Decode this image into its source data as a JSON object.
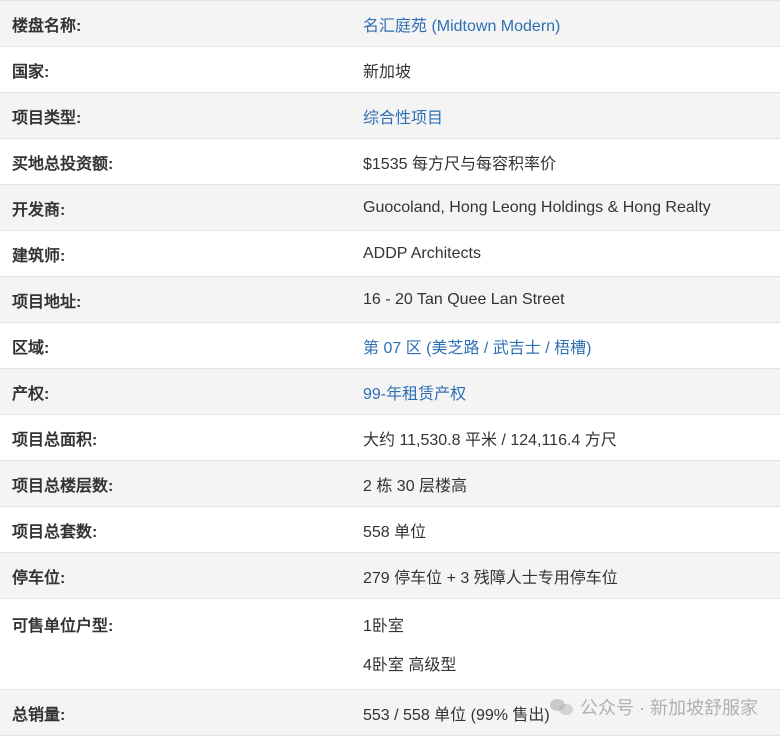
{
  "rows": [
    {
      "label": "楼盘名称:",
      "value": "名汇庭苑 (Midtown Modern)"
    },
    {
      "label": "国家:",
      "value": "新加坡"
    },
    {
      "label": "项目类型:",
      "value": "综合性项目"
    },
    {
      "label": "买地总投资额:",
      "value": "$1535 每方尺与每容积率价"
    },
    {
      "label": "开发商:",
      "value": "Guocoland, Hong Leong Holdings & Hong Realty"
    },
    {
      "label": "建筑师:",
      "value": "ADDP Architects"
    },
    {
      "label": "项目地址:",
      "value": "16 - 20 Tan Quee Lan Street"
    },
    {
      "label": "区域:",
      "value": "第 07 区 (美芝路 / 武吉士 / 梧槽)"
    },
    {
      "label": "产权:",
      "value": "99-年租赁产权"
    },
    {
      "label": "项目总面积:",
      "value": "大约 11,530.8 平米 / 124,116.4 方尺"
    },
    {
      "label": "项目总楼层数:",
      "value": "2 栋 30 层楼高"
    },
    {
      "label": "项目总套数:",
      "value": "558 单位"
    },
    {
      "label": "停车位:",
      "value": "279 停车位 + 3 残障人士专用停车位"
    },
    {
      "label": "可售单位户型:",
      "values": [
        "1卧室",
        "4卧室 高级型"
      ]
    },
    {
      "label": "总销量:",
      "value": "553 / 558 单位 (99% 售出)"
    }
  ],
  "watermark": {
    "text": "公众号 · 新加坡舒服家"
  },
  "colors": {
    "link": "#2f6fb5",
    "alt_row": "#f4f4f4",
    "border": "#e2e2e2"
  }
}
